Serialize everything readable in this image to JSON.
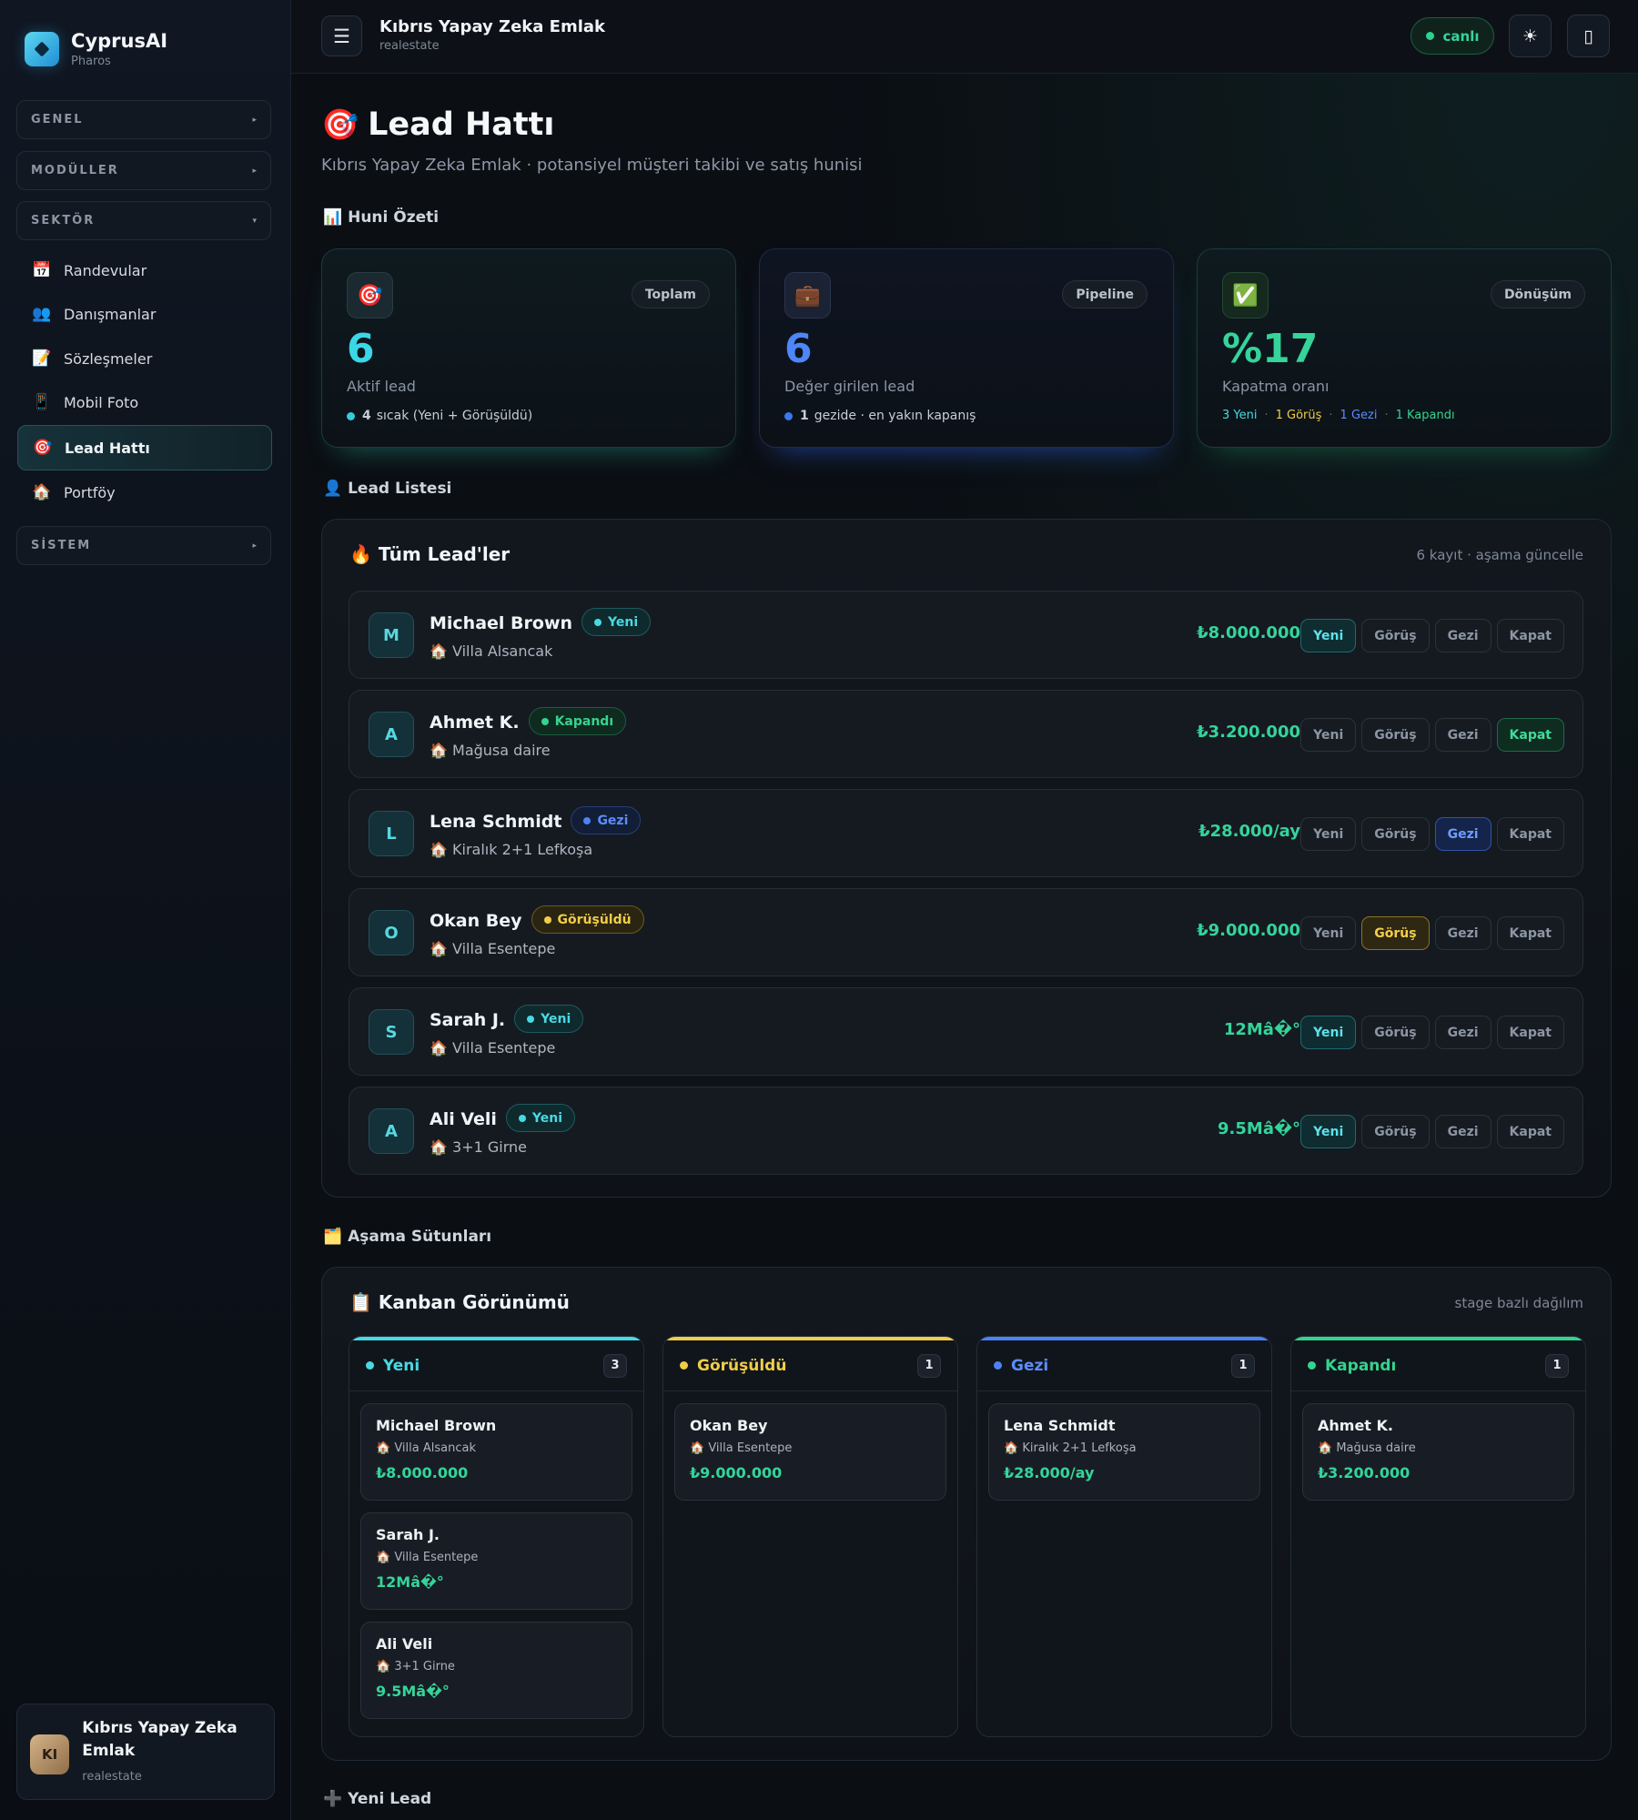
{
  "brand": {
    "name": "CyprusAI",
    "sub": "Pharos"
  },
  "sidebar": {
    "groups": [
      {
        "label": "GENEL",
        "arrow": "▸"
      },
      {
        "label": "MODÜLLER",
        "arrow": "▸"
      },
      {
        "label": "SEKTÖR",
        "arrow": "▾"
      },
      {
        "label": "SİSTEM",
        "arrow": "▸"
      }
    ],
    "items": [
      {
        "icon": "📅",
        "label": "Randevular"
      },
      {
        "icon": "👥",
        "label": "Danışmanlar"
      },
      {
        "icon": "📝",
        "label": "Sözleşmeler"
      },
      {
        "icon": "📱",
        "label": "Mobil Foto"
      },
      {
        "icon": "🎯",
        "label": "Lead Hattı"
      },
      {
        "icon": "🏠",
        "label": "Portföy"
      }
    ],
    "user": {
      "initials": "KI",
      "name": "Kıbrıs Yapay Zeka Emlak",
      "role": "realestate"
    }
  },
  "topbar": {
    "title": "Kıbrıs Yapay Zeka Emlak",
    "sub": "realestate",
    "live": "canlı",
    "menu_icon": "☰",
    "theme_icon": "☀",
    "device_icon": "▯"
  },
  "page": {
    "icon": "🎯",
    "title": "Lead Hattı",
    "subtitle": "Kıbrıs Yapay Zeka Emlak · potansiyel müşteri takibi ve satış hunisi"
  },
  "sections": {
    "summary": "📊 Huni Özeti",
    "list": "👤 Lead Listesi",
    "columns": "🗂️ Aşama Sütunları",
    "new": "➕ Yeni Lead"
  },
  "stats": [
    {
      "icon": "🎯",
      "tag": "Toplam",
      "value": "6",
      "label": "Aktif lead",
      "foot_num": "4",
      "foot_text": "sıcak (Yeni + Görüşüldü)",
      "color": "#3ad7e6",
      "dot": "#36c9e0"
    },
    {
      "icon": "💼",
      "tag": "Pipeline",
      "value": "6",
      "label": "Değer girilen lead",
      "foot_num": "1",
      "foot_text": "gezide · en yakın kapanış",
      "color": "#4d86f7",
      "dot": "#3b77f0"
    },
    {
      "icon": "✅",
      "tag": "Dönüşüm",
      "value": "%17",
      "label": "Kapatma oranı",
      "breakdown": [
        "3 Yeni",
        "1 Görüş",
        "1 Gezi",
        "1 Kapandı"
      ],
      "color": "#35d49a"
    }
  ],
  "lead_panel": {
    "title": "🔥 Tüm Lead'ler",
    "meta": "6 kayıt · aşama güncelle",
    "stage_buttons": [
      "Yeni",
      "Görüş",
      "Gezi",
      "Kapat"
    ]
  },
  "leads": [
    {
      "initial": "M",
      "name": "Michael Brown",
      "status": "Yeni",
      "property": "🏠 Villa Alsancak",
      "price": "₺8.000.000"
    },
    {
      "initial": "A",
      "name": "Ahmet K.",
      "status": "Kapandı",
      "property": "🏠 Mağusa daire",
      "price": "₺3.200.000"
    },
    {
      "initial": "L",
      "name": "Lena Schmidt",
      "status": "Gezi",
      "property": "🏠 Kiralık 2+1 Lefkoşa",
      "price": "₺28.000/ay"
    },
    {
      "initial": "O",
      "name": "Okan Bey",
      "status": "Görüşüldü",
      "property": "🏠 Villa Esentepe",
      "price": "₺9.000.000"
    },
    {
      "initial": "S",
      "name": "Sarah J.",
      "status": "Yeni",
      "property": "🏠 Villa Esentepe",
      "price": "12Mâ�°"
    },
    {
      "initial": "A",
      "name": "Ali Veli",
      "status": "Yeni",
      "property": "🏠 3+1 Girne",
      "price": "9.5Mâ�°"
    }
  ],
  "kanban": {
    "title": "📋 Kanban Görünümü",
    "meta": "stage bazlı dağılım",
    "columns": [
      {
        "name": "Yeni",
        "count": "3",
        "color": "#49d9e3",
        "cards": [
          {
            "name": "Michael Brown",
            "property": "🏠 Villa Alsancak",
            "price": "₺8.000.000"
          },
          {
            "name": "Sarah J.",
            "property": "🏠 Villa Esentepe",
            "price": "12Mâ�°"
          },
          {
            "name": "Ali Veli",
            "property": "🏠 3+1 Girne",
            "price": "9.5Mâ�°"
          }
        ]
      },
      {
        "name": "Görüşüldü",
        "count": "1",
        "color": "#f1cc49",
        "cards": [
          {
            "name": "Okan Bey",
            "property": "🏠 Villa Esentepe",
            "price": "₺9.000.000"
          }
        ]
      },
      {
        "name": "Gezi",
        "count": "1",
        "color": "#4d82f7",
        "cards": [
          {
            "name": "Lena Schmidt",
            "property": "🏠 Kiralık 2+1 Lefkoşa",
            "price": "₺28.000/ay"
          }
        ]
      },
      {
        "name": "Kapandı",
        "count": "1",
        "color": "#34d48f",
        "cards": [
          {
            "name": "Ahmet K.",
            "property": "🏠 Mağusa daire",
            "price": "₺3.200.000"
          }
        ]
      }
    ]
  }
}
